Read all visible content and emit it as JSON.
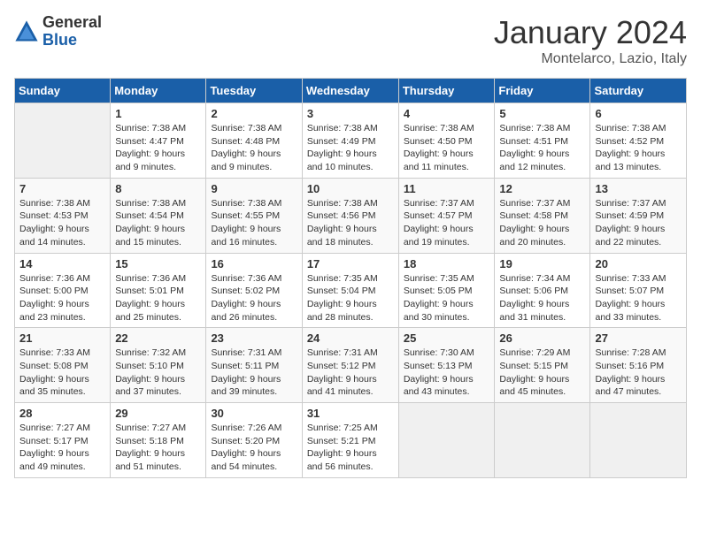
{
  "logo": {
    "general": "General",
    "blue": "Blue"
  },
  "title": "January 2024",
  "location": "Montelarco, Lazio, Italy",
  "days_of_week": [
    "Sunday",
    "Monday",
    "Tuesday",
    "Wednesday",
    "Thursday",
    "Friday",
    "Saturday"
  ],
  "weeks": [
    [
      {
        "day": "",
        "info": ""
      },
      {
        "day": "1",
        "info": "Sunrise: 7:38 AM\nSunset: 4:47 PM\nDaylight: 9 hours\nand 9 minutes."
      },
      {
        "day": "2",
        "info": "Sunrise: 7:38 AM\nSunset: 4:48 PM\nDaylight: 9 hours\nand 9 minutes."
      },
      {
        "day": "3",
        "info": "Sunrise: 7:38 AM\nSunset: 4:49 PM\nDaylight: 9 hours\nand 10 minutes."
      },
      {
        "day": "4",
        "info": "Sunrise: 7:38 AM\nSunset: 4:50 PM\nDaylight: 9 hours\nand 11 minutes."
      },
      {
        "day": "5",
        "info": "Sunrise: 7:38 AM\nSunset: 4:51 PM\nDaylight: 9 hours\nand 12 minutes."
      },
      {
        "day": "6",
        "info": "Sunrise: 7:38 AM\nSunset: 4:52 PM\nDaylight: 9 hours\nand 13 minutes."
      }
    ],
    [
      {
        "day": "7",
        "info": "Sunrise: 7:38 AM\nSunset: 4:53 PM\nDaylight: 9 hours\nand 14 minutes."
      },
      {
        "day": "8",
        "info": "Sunrise: 7:38 AM\nSunset: 4:54 PM\nDaylight: 9 hours\nand 15 minutes."
      },
      {
        "day": "9",
        "info": "Sunrise: 7:38 AM\nSunset: 4:55 PM\nDaylight: 9 hours\nand 16 minutes."
      },
      {
        "day": "10",
        "info": "Sunrise: 7:38 AM\nSunset: 4:56 PM\nDaylight: 9 hours\nand 18 minutes."
      },
      {
        "day": "11",
        "info": "Sunrise: 7:37 AM\nSunset: 4:57 PM\nDaylight: 9 hours\nand 19 minutes."
      },
      {
        "day": "12",
        "info": "Sunrise: 7:37 AM\nSunset: 4:58 PM\nDaylight: 9 hours\nand 20 minutes."
      },
      {
        "day": "13",
        "info": "Sunrise: 7:37 AM\nSunset: 4:59 PM\nDaylight: 9 hours\nand 22 minutes."
      }
    ],
    [
      {
        "day": "14",
        "info": "Sunrise: 7:36 AM\nSunset: 5:00 PM\nDaylight: 9 hours\nand 23 minutes."
      },
      {
        "day": "15",
        "info": "Sunrise: 7:36 AM\nSunset: 5:01 PM\nDaylight: 9 hours\nand 25 minutes."
      },
      {
        "day": "16",
        "info": "Sunrise: 7:36 AM\nSunset: 5:02 PM\nDaylight: 9 hours\nand 26 minutes."
      },
      {
        "day": "17",
        "info": "Sunrise: 7:35 AM\nSunset: 5:04 PM\nDaylight: 9 hours\nand 28 minutes."
      },
      {
        "day": "18",
        "info": "Sunrise: 7:35 AM\nSunset: 5:05 PM\nDaylight: 9 hours\nand 30 minutes."
      },
      {
        "day": "19",
        "info": "Sunrise: 7:34 AM\nSunset: 5:06 PM\nDaylight: 9 hours\nand 31 minutes."
      },
      {
        "day": "20",
        "info": "Sunrise: 7:33 AM\nSunset: 5:07 PM\nDaylight: 9 hours\nand 33 minutes."
      }
    ],
    [
      {
        "day": "21",
        "info": "Sunrise: 7:33 AM\nSunset: 5:08 PM\nDaylight: 9 hours\nand 35 minutes."
      },
      {
        "day": "22",
        "info": "Sunrise: 7:32 AM\nSunset: 5:10 PM\nDaylight: 9 hours\nand 37 minutes."
      },
      {
        "day": "23",
        "info": "Sunrise: 7:31 AM\nSunset: 5:11 PM\nDaylight: 9 hours\nand 39 minutes."
      },
      {
        "day": "24",
        "info": "Sunrise: 7:31 AM\nSunset: 5:12 PM\nDaylight: 9 hours\nand 41 minutes."
      },
      {
        "day": "25",
        "info": "Sunrise: 7:30 AM\nSunset: 5:13 PM\nDaylight: 9 hours\nand 43 minutes."
      },
      {
        "day": "26",
        "info": "Sunrise: 7:29 AM\nSunset: 5:15 PM\nDaylight: 9 hours\nand 45 minutes."
      },
      {
        "day": "27",
        "info": "Sunrise: 7:28 AM\nSunset: 5:16 PM\nDaylight: 9 hours\nand 47 minutes."
      }
    ],
    [
      {
        "day": "28",
        "info": "Sunrise: 7:27 AM\nSunset: 5:17 PM\nDaylight: 9 hours\nand 49 minutes."
      },
      {
        "day": "29",
        "info": "Sunrise: 7:27 AM\nSunset: 5:18 PM\nDaylight: 9 hours\nand 51 minutes."
      },
      {
        "day": "30",
        "info": "Sunrise: 7:26 AM\nSunset: 5:20 PM\nDaylight: 9 hours\nand 54 minutes."
      },
      {
        "day": "31",
        "info": "Sunrise: 7:25 AM\nSunset: 5:21 PM\nDaylight: 9 hours\nand 56 minutes."
      },
      {
        "day": "",
        "info": ""
      },
      {
        "day": "",
        "info": ""
      },
      {
        "day": "",
        "info": ""
      }
    ]
  ]
}
